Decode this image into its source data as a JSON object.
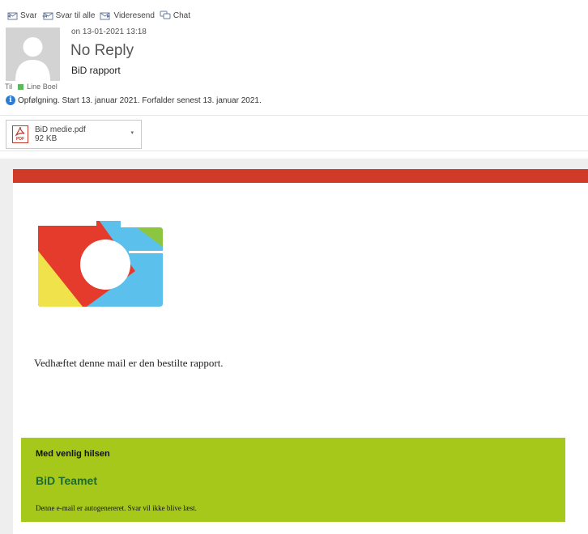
{
  "toolbar": {
    "reply": "Svar",
    "reply_all": "Svar til alle",
    "forward": "Videresend",
    "chat": "Chat"
  },
  "header": {
    "date": "on 13-01-2021 13:18",
    "sender": "No Reply",
    "subject": "BiD rapport",
    "to_label": "Til",
    "recipient": "Line Boel",
    "followup": "Opfølgning. Start 13. januar 2021. Forfalder senest 13. januar 2021."
  },
  "attachment": {
    "name": "BiD medie.pdf",
    "size": "92 KB",
    "type_label": "PDF"
  },
  "body": {
    "message": "Vedhæftet denne mail er den bestilte rapport.",
    "signature_greeting": "Med venlig hilsen",
    "signature_team": "BiD Teamet",
    "signature_note": "Denne e-mail er autogenereret. Svar vil ikke blive læst."
  },
  "colors": {
    "brand_red": "#cf3b28",
    "signature_green": "#a6c81a",
    "team_text_green": "#1d6b2f",
    "presence_green": "#5cb85c"
  }
}
